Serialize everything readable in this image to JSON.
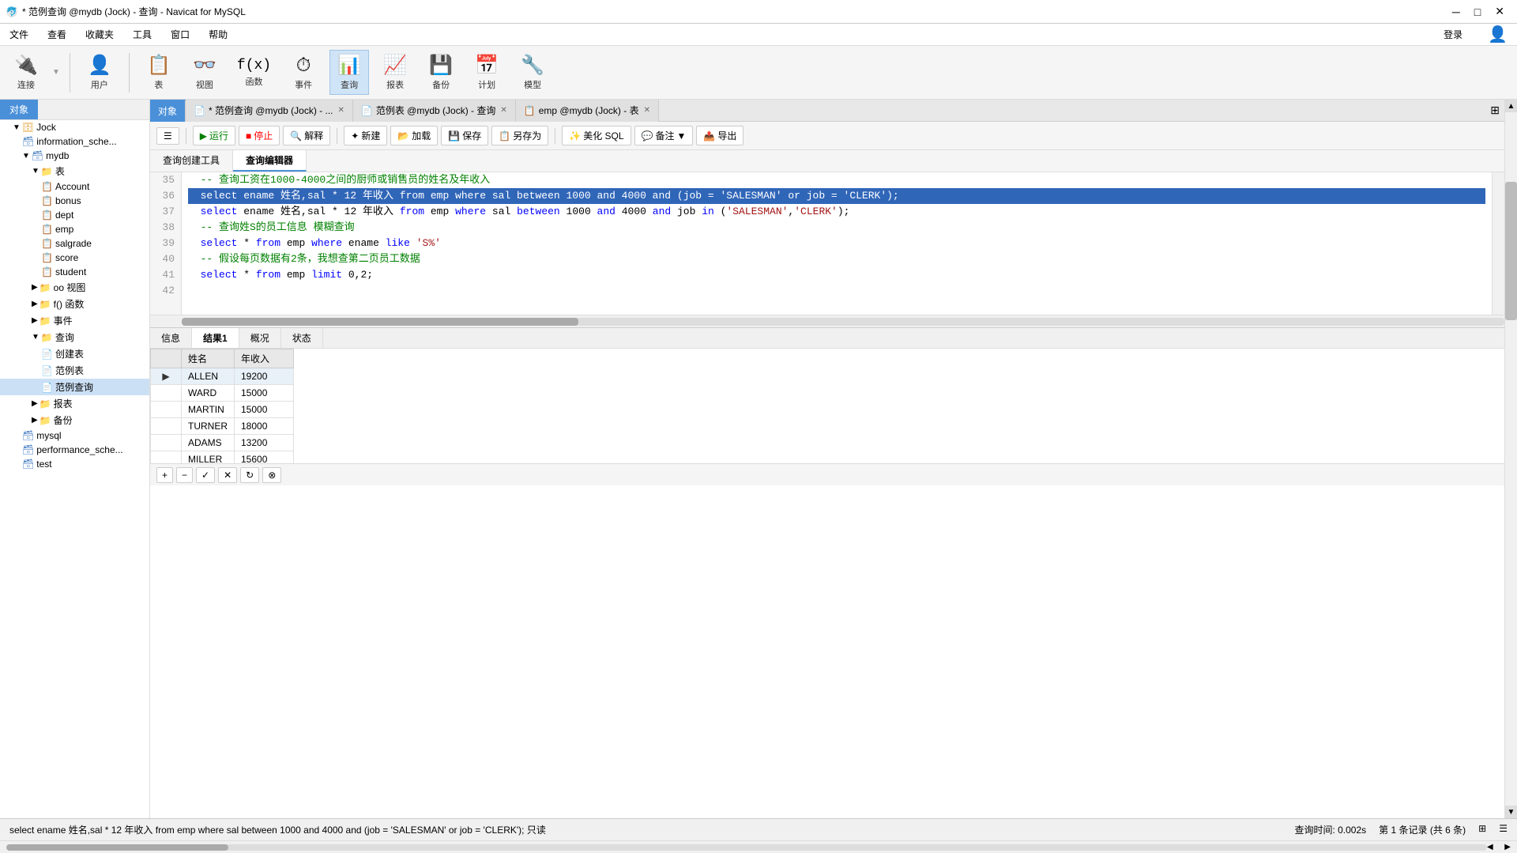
{
  "titlebar": {
    "title": "* 范例查询 @mydb (Jock) - 查询 - Navicat for MySQL",
    "min": "─",
    "max": "□",
    "close": "✕"
  },
  "menubar": {
    "items": [
      "文件",
      "查看",
      "收藏夹",
      "工具",
      "窗口",
      "帮助"
    ]
  },
  "toolbar": {
    "items": [
      {
        "id": "connect",
        "icon": "🔌",
        "label": "连接"
      },
      {
        "id": "user",
        "icon": "👤",
        "label": "用户"
      },
      {
        "id": "table",
        "icon": "📋",
        "label": "表"
      },
      {
        "id": "view",
        "icon": "👓",
        "label": "视图"
      },
      {
        "id": "func",
        "icon": "f(x)",
        "label": "函数"
      },
      {
        "id": "event",
        "icon": "⏱",
        "label": "事件"
      },
      {
        "id": "query",
        "icon": "📊",
        "label": "查询",
        "active": true
      },
      {
        "id": "report",
        "icon": "📈",
        "label": "报表"
      },
      {
        "id": "backup",
        "icon": "💾",
        "label": "备份"
      },
      {
        "id": "schedule",
        "icon": "📅",
        "label": "计划"
      },
      {
        "id": "model",
        "icon": "🔧",
        "label": "模型"
      }
    ],
    "login": "登录"
  },
  "tabs": [
    {
      "id": "obj",
      "label": "对象",
      "active": true,
      "closable": false
    },
    {
      "id": "query-edit",
      "label": "* 范例查询 @mydb (Jock) - ...",
      "active": false,
      "closable": true
    },
    {
      "id": "fanli-biao",
      "label": "范例表 @mydb (Jock) - 查询",
      "active": false,
      "closable": true
    },
    {
      "id": "emp-biao",
      "label": "emp @mydb (Jock) - 表",
      "active": false,
      "closable": true
    }
  ],
  "query_toolbar": {
    "run": "运行",
    "stop": "停止",
    "explain": "解释",
    "new": "新建",
    "load": "加载",
    "save": "保存",
    "save_as": "另存为",
    "beautify": "美化 SQL",
    "comment": "备注",
    "export": "导出"
  },
  "subtabs": [
    "查询创建工具",
    "查询编辑器"
  ],
  "code": {
    "lines": [
      {
        "num": 35,
        "text": "  -- 查询工资在1000-4000之间的厨师或销售员的姓名及年收入",
        "highlight": false,
        "type": "comment"
      },
      {
        "num": 36,
        "text": "  select ename 姓名,sal * 12 年收入 from emp where sal between 1000 and 4000 and (job = 'SALESMAN' or job = 'CLERK');",
        "highlight": true,
        "type": "sql"
      },
      {
        "num": 37,
        "text": "  select ename 姓名,sal * 12 年收入 from emp where sal between 1000 and 4000 and job in ('SALESMAN','CLERK');",
        "highlight": false,
        "type": "sql"
      },
      {
        "num": 38,
        "text": "  -- 查询姓S的员工信息 模糊查询",
        "highlight": false,
        "type": "comment"
      },
      {
        "num": 39,
        "text": "  select * from emp where ename like 'S%'",
        "highlight": false,
        "type": "sql"
      },
      {
        "num": 40,
        "text": "  -- 假设每页数据有2条，我想查第二页员工数据",
        "highlight": false,
        "type": "comment"
      },
      {
        "num": 41,
        "text": "  select * from emp limit 0,2;",
        "highlight": false,
        "type": "sql"
      },
      {
        "num": 42,
        "text": "",
        "highlight": false,
        "type": "empty"
      }
    ]
  },
  "result_tabs": [
    "信息",
    "结果1",
    "概况",
    "状态"
  ],
  "result_active_tab": "结果1",
  "result_columns": [
    "",
    "姓名",
    "年收入"
  ],
  "result_rows": [
    {
      "indicator": "▶",
      "name": "ALLEN",
      "salary": "19200",
      "first": true
    },
    {
      "indicator": "",
      "name": "WARD",
      "salary": "15000",
      "first": false
    },
    {
      "indicator": "",
      "name": "MARTIN",
      "salary": "15000",
      "first": false
    },
    {
      "indicator": "",
      "name": "TURNER",
      "salary": "18000",
      "first": false
    },
    {
      "indicator": "",
      "name": "ADAMS",
      "salary": "13200",
      "first": false
    },
    {
      "indicator": "",
      "name": "MILLER",
      "salary": "15600",
      "first": false
    }
  ],
  "statusbar": {
    "text": "select ename 姓名,sal * 12 年收入 from emp where sal between 1000 and 4000 and (job = 'SALESMAN' or job = 'CLERK');  只读",
    "time": "查询时间: 0.002s",
    "records": "第 1 条记录 (共 6 条)"
  },
  "sidebar": {
    "items": [
      {
        "id": "jock",
        "label": "Jock",
        "level": 0,
        "type": "db-group",
        "expanded": true
      },
      {
        "id": "information_schema",
        "label": "information_sche...",
        "level": 1,
        "type": "db"
      },
      {
        "id": "mydb",
        "label": "mydb",
        "level": 1,
        "type": "db",
        "expanded": true
      },
      {
        "id": "tables",
        "label": "表",
        "level": 2,
        "type": "folder",
        "expanded": true
      },
      {
        "id": "account",
        "label": "Account",
        "level": 3,
        "type": "table"
      },
      {
        "id": "bonus",
        "label": "bonus",
        "level": 3,
        "type": "table"
      },
      {
        "id": "dept",
        "label": "dept",
        "level": 3,
        "type": "table"
      },
      {
        "id": "emp",
        "label": "emp",
        "level": 3,
        "type": "table"
      },
      {
        "id": "salgrade",
        "label": "salgrade",
        "level": 3,
        "type": "table"
      },
      {
        "id": "score",
        "label": "score",
        "level": 3,
        "type": "table"
      },
      {
        "id": "student",
        "label": "student",
        "level": 3,
        "type": "table"
      },
      {
        "id": "views",
        "label": "视图",
        "level": 2,
        "type": "folder"
      },
      {
        "id": "funcs",
        "label": "函数",
        "level": 2,
        "type": "folder"
      },
      {
        "id": "events",
        "label": "事件",
        "level": 2,
        "type": "folder"
      },
      {
        "id": "queries",
        "label": "查询",
        "level": 2,
        "type": "folder",
        "expanded": true
      },
      {
        "id": "createtable",
        "label": "创建表",
        "level": 3,
        "type": "query"
      },
      {
        "id": "fanli-biao-item",
        "label": "范例表",
        "level": 3,
        "type": "query"
      },
      {
        "id": "fanli-chaxun",
        "label": "范例查询",
        "level": 3,
        "type": "query",
        "selected": true
      },
      {
        "id": "reports",
        "label": "报表",
        "level": 2,
        "type": "folder"
      },
      {
        "id": "backups",
        "label": "备份",
        "level": 2,
        "type": "folder"
      },
      {
        "id": "mysql",
        "label": "mysql",
        "level": 1,
        "type": "db"
      },
      {
        "id": "performance_schema",
        "label": "performance_sche...",
        "level": 1,
        "type": "db"
      },
      {
        "id": "test",
        "label": "test",
        "level": 1,
        "type": "db"
      }
    ]
  }
}
